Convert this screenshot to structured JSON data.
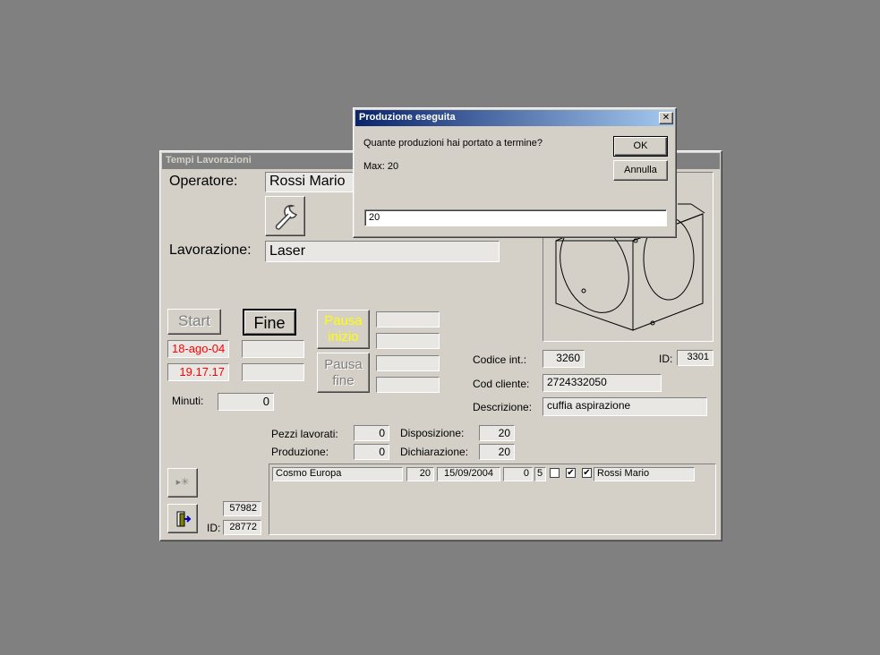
{
  "main_window": {
    "title": "Tempi Lavorazioni",
    "operator_label": "Operatore:",
    "operator_value": "Rossi Mario",
    "processing_label": "Lavorazione:",
    "processing_value": "Laser",
    "start_label": "Start",
    "end_label": "Fine",
    "pause_start_label_1": "Pausa",
    "pause_start_label_2": "inizio",
    "pause_end_label_1": "Pausa",
    "pause_end_label_2": "fine",
    "date_value": "18-ago-04",
    "time_value": "19.17.17",
    "minutes_label": "Minuti:",
    "minutes_value": "0",
    "internal_code_label": "Codice  int.:",
    "internal_code_value": "3260",
    "id_label": "ID:",
    "id_value": "3301",
    "client_code_label": "Cod cliente:",
    "client_code_value": "2724332050",
    "description_label": "Descrizione:",
    "description_value": "cuffia aspirazione",
    "pieces_label": "Pezzi lavorati:",
    "pieces_value": "0",
    "production_label": "Produzione:",
    "production_value": "0",
    "disposition_label": "Disposizione:",
    "disposition_value": "20",
    "declaration_label": "Dichiarazione:",
    "declaration_value": "20",
    "record_number": "57982",
    "bottom_id_label": "ID:",
    "bottom_id_value": "28772",
    "list_row": {
      "client": "Cosmo Europa",
      "qty": "20",
      "date": "15/09/2004",
      "num1": "0",
      "num2": "5",
      "check1": false,
      "check2": true,
      "check3": true,
      "operator": "Rossi Mario"
    }
  },
  "dialog": {
    "title": "Produzione eseguita",
    "prompt": "Quante produzioni hai portato a termine?",
    "max_text": "Max:  20",
    "ok_label": "OK",
    "cancel_label": "Annulla",
    "input_value": "20",
    "close_glyph": "✕"
  },
  "colors": {
    "red_text": "#ff0000",
    "yellow_text": "#ffff00",
    "disabled_text": "#808080"
  }
}
